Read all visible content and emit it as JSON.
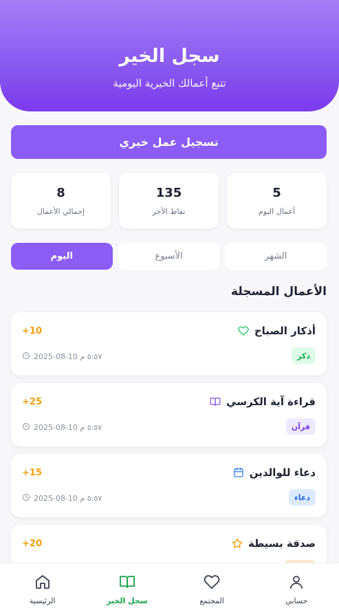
{
  "header": {
    "title": "سجل الخير",
    "subtitle": "تتبع أعمالك الخيرية اليومية",
    "gradient_colors": [
      "#a57cf6",
      "#7c3aed"
    ]
  },
  "cta": {
    "label": "تسجيل عمل خيري",
    "color": "#8b5cf6"
  },
  "stats": [
    {
      "value": "5",
      "label": "أعمال اليوم"
    },
    {
      "value": "135",
      "label": "نقاط الأجر"
    },
    {
      "value": "8",
      "label": "إجمالي الأعمال"
    }
  ],
  "tabs": [
    {
      "label": "الشهر",
      "active": false
    },
    {
      "label": "الأسبوع",
      "active": false
    },
    {
      "label": "اليوم",
      "active": true
    }
  ],
  "section_title": "الأعمال المسجلة",
  "deeds": [
    {
      "name": "أذكار الصباح",
      "icon": "heart-icon",
      "icon_color": "#22c55e",
      "points": "+10",
      "tag": "ذكر",
      "tag_bg": "#dcfce7",
      "tag_color": "#16a34a",
      "date": "2025-08-10 ٥:٥٧ م"
    },
    {
      "name": "قراءة آية الكرسي",
      "icon": "book-icon",
      "icon_color": "#8b5cf6",
      "points": "+25",
      "tag": "قرآن",
      "tag_bg": "#ede9fe",
      "tag_color": "#7c3aed",
      "date": "2025-08-10 ٥:٥٧ م"
    },
    {
      "name": "دعاء للوالدين",
      "icon": "calendar-icon",
      "icon_color": "#3b82f6",
      "points": "+15",
      "tag": "دعاء",
      "tag_bg": "#dbeafe",
      "tag_color": "#2563eb",
      "date": "2025-08-10 ٥:٥٧ م"
    },
    {
      "name": "صدقة بسيطة",
      "icon": "star-icon",
      "icon_color": "#f59e0b",
      "points": "+20",
      "tag": "",
      "tag_bg": "#fde7cf",
      "tag_color": "#ea580c",
      "date": ""
    }
  ],
  "bottom_nav": [
    {
      "label": "حسابي",
      "icon": "user-icon",
      "active": false
    },
    {
      "label": "المجتمع",
      "icon": "heart-icon",
      "active": false
    },
    {
      "label": "سجل الخير",
      "icon": "book-open-icon",
      "active": true
    },
    {
      "label": "الرئيسية",
      "icon": "home-icon",
      "active": false
    }
  ],
  "colors": {
    "points": "#f59e0b",
    "active_nav": "#16a34a",
    "accent": "#8b5cf6"
  }
}
